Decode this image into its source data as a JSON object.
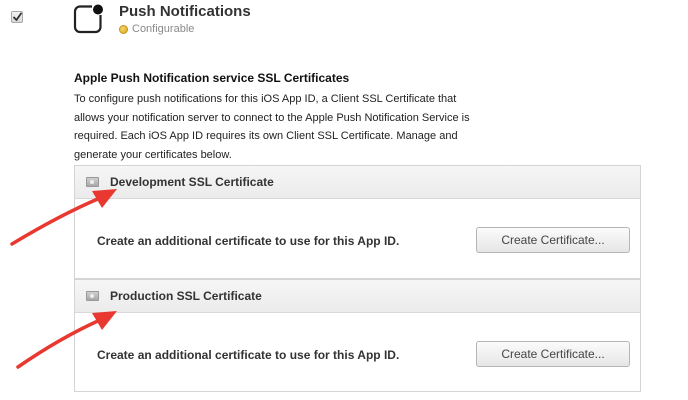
{
  "service": {
    "title": "Push Notifications",
    "status": "Configurable",
    "status_color": "#dba91b",
    "checked": true
  },
  "section": {
    "heading": "Apple Push Notification service SSL Certificates",
    "description": "To configure push notifications for this iOS App ID, a Client SSL Certificate that allows your notification server to connect to the Apple Push Notification Service is required. Each iOS App ID requires its own Client SSL Certificate. Manage and generate your certificates below."
  },
  "certificates": [
    {
      "title": "Development SSL Certificate",
      "text": "Create an additional certificate to use for this App ID.",
      "button_label": "Create Certificate..."
    },
    {
      "title": "Production SSL Certificate",
      "text": "Create an additional certificate to use for this App ID.",
      "button_label": "Create Certificate..."
    }
  ],
  "annotation": {
    "arrow_color": "#e8382f"
  }
}
